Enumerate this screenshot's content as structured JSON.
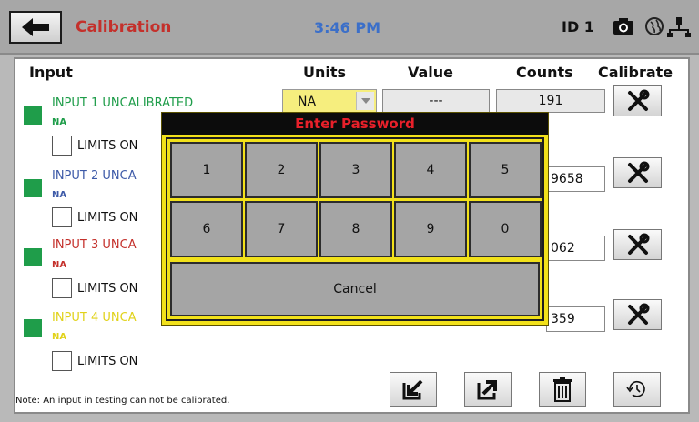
{
  "header": {
    "back_icon": "arrow-left-icon",
    "title": "Calibration",
    "time": "3:46 PM",
    "id_label": "ID 1",
    "icons": [
      "camera-icon",
      "globe-icon",
      "network-icon"
    ]
  },
  "columns": {
    "input": "Input",
    "units": "Units",
    "value": "Value",
    "counts": "Counts",
    "calibrate": "Calibrate"
  },
  "inputs": [
    {
      "name": "INPUT 1 UNCALIBRATED",
      "unit": "NA",
      "color": "#1f9d4a",
      "limits": "LIMITS ON",
      "units_value": "NA",
      "value": "---",
      "counts": "191"
    },
    {
      "name": "INPUT 2 UNCA",
      "unit": "NA",
      "color": "#3d5aa8",
      "limits": "LIMITS ON",
      "counts": "9658"
    },
    {
      "name": "INPUT 3 UNCA",
      "unit": "NA",
      "color": "#c4302b",
      "limits": "LIMITS ON",
      "counts": "062"
    },
    {
      "name": "INPUT 4 UNCA",
      "unit": "NA",
      "color": "#e1d21a",
      "limits": "LIMITS ON",
      "counts": "359"
    }
  ],
  "calibrate_icon": "wrench-screwdriver-icon",
  "bottom_buttons": [
    "import-icon",
    "export-icon",
    "trash-icon",
    "history-icon"
  ],
  "note": "Note:  An input in testing can not be calibrated.",
  "dialog": {
    "title": "Enter Password",
    "keys": [
      "1",
      "2",
      "3",
      "4",
      "5",
      "6",
      "7",
      "8",
      "9",
      "0"
    ],
    "cancel": "Cancel"
  }
}
